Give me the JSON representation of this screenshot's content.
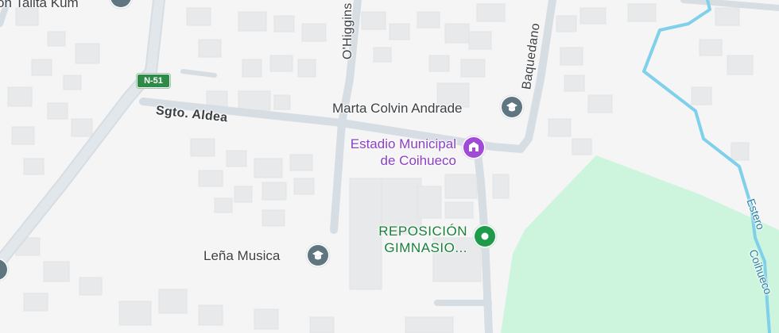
{
  "map": {
    "streets": [
      "Sgto. Aldea",
      "O'Higgins",
      "Baquedano"
    ],
    "route_shield": "N-51",
    "water_labels": [
      "Estero",
      "Coihueco"
    ],
    "pois": [
      {
        "name": "Marta Colvin Andrade",
        "icon": "school-icon"
      },
      {
        "name_line1": "Estadio Municipal",
        "name_line2": "de Coihueco",
        "icon": "stadium-icon"
      },
      {
        "name_line1": "REPOSICIÓN",
        "name_line2": "GIMNASIO...",
        "icon": "place-pin-icon"
      },
      {
        "name": "Leña Musica",
        "icon": "school-icon"
      },
      {
        "name": "on Talita Kum",
        "icon": "place-icon"
      }
    ],
    "colors": {
      "background": "#f5f5f5",
      "road": "#d6dde3",
      "building": "#e8e9eb",
      "park": "#cdf5dd",
      "water": "#7fd0ea",
      "school_icon": "#5f7680",
      "stadium_icon": "#a04bd6",
      "gym_icon": "#1e9a4b",
      "shield": "#2e8b47"
    }
  }
}
